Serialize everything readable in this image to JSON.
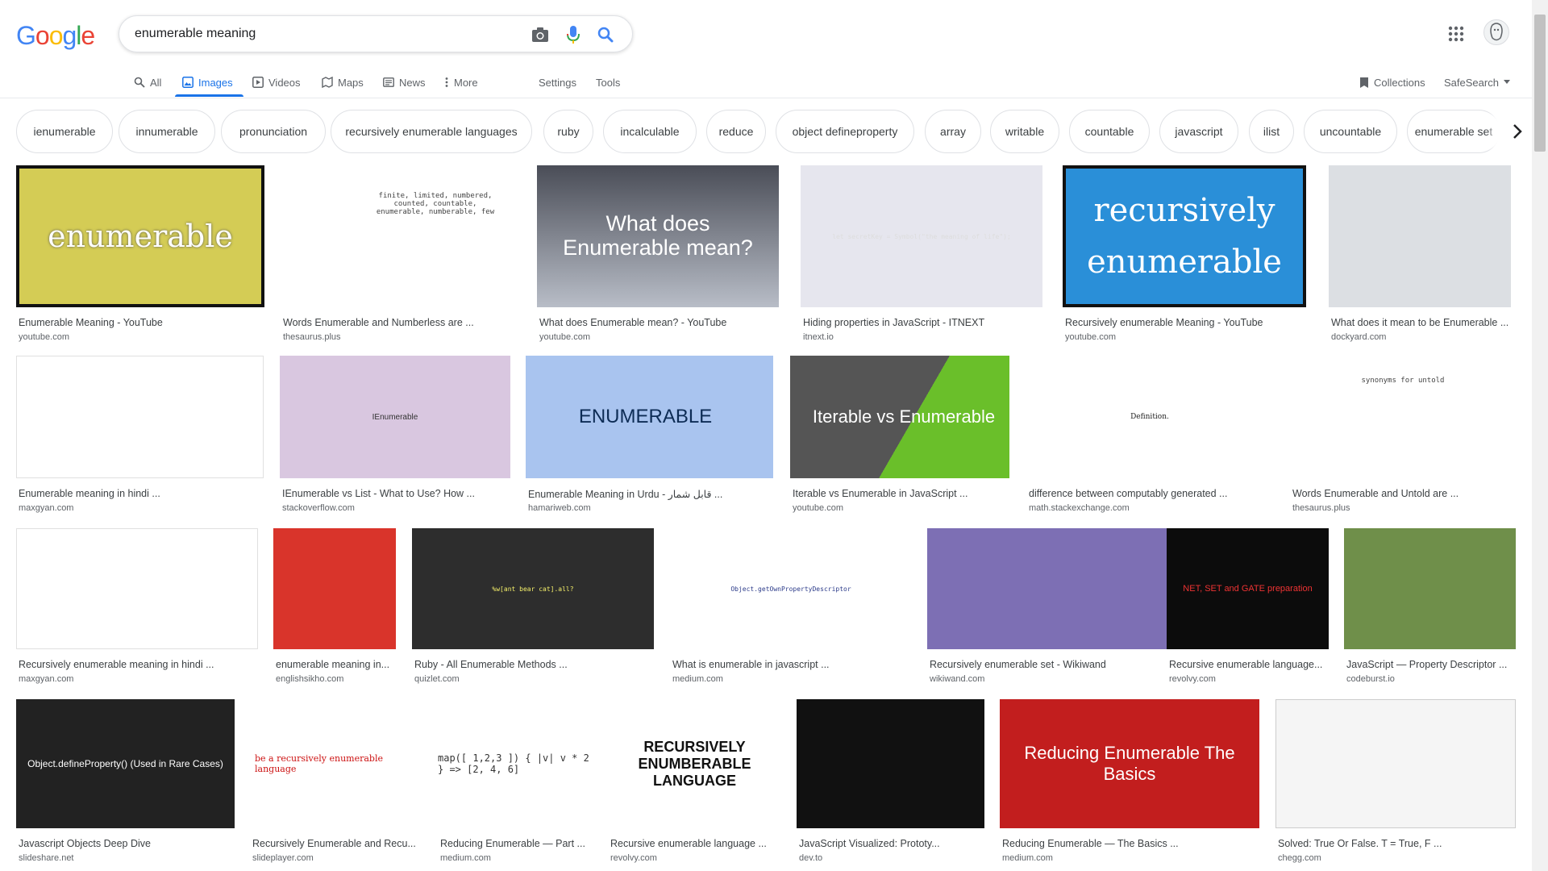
{
  "logo": {
    "letters": [
      "G",
      "o",
      "o",
      "g",
      "l",
      "e"
    ],
    "colors": [
      "#4285f4",
      "#ea4335",
      "#fbbc05",
      "#4285f4",
      "#34a853",
      "#ea4335"
    ]
  },
  "search": {
    "query": "enumerable meaning"
  },
  "nav": {
    "items": [
      {
        "label": "All",
        "icon": "search-icon",
        "active": false
      },
      {
        "label": "Images",
        "icon": "image-icon",
        "active": true
      },
      {
        "label": "Videos",
        "icon": "video-icon",
        "active": false
      },
      {
        "label": "Maps",
        "icon": "map-icon",
        "active": false
      },
      {
        "label": "News",
        "icon": "news-icon",
        "active": false
      },
      {
        "label": "More",
        "icon": "more-vert-icon",
        "active": false
      }
    ],
    "settings": "Settings",
    "tools": "Tools",
    "collections": "Collections",
    "safesearch": "SafeSearch"
  },
  "chips": [
    "ienumerable",
    "innumerable",
    "pronunciation",
    "recursively enumerable languages",
    "ruby",
    "incalculable",
    "reduce",
    "object defineproperty",
    "array",
    "writable",
    "countable",
    "javascript",
    "ilist",
    "uncountable",
    "enumerable set"
  ],
  "results": [
    {
      "title": "Enumerable Meaning - YouTube",
      "source": "youtube.com",
      "thumb_text": "enumerable"
    },
    {
      "title": "Words Enumerable and Numberless are ...",
      "source": "thesaurus.plus",
      "thumb_text": "finite, limited, numbered, counted, countable, enumerable, numberable, few"
    },
    {
      "title": "What does Enumerable mean? - YouTube",
      "source": "youtube.com",
      "thumb_text": "What does Enumerable mean?"
    },
    {
      "title": "Hiding properties in JavaScript - ITNEXT",
      "source": "itnext.io",
      "thumb_text": "let secretKey = Symbol(\"the meaning of life\");"
    },
    {
      "title": "Recursively enumerable Meaning - YouTube",
      "source": "youtube.com",
      "thumb_text": "recursively enumerable"
    },
    {
      "title": "What does it mean to be Enumerable ...",
      "source": "dockyard.com",
      "thumb_text": ""
    },
    {
      "title": "Enumerable meaning in hindi ...",
      "source": "maxgyan.com",
      "thumb_text": ""
    },
    {
      "title": "IEnumerable vs List - What to Use? How ...",
      "source": "stackoverflow.com",
      "thumb_text": "IEnumerable"
    },
    {
      "title": "Enumerable Meaning in Urdu - قابل شمار ...",
      "source": "hamariweb.com",
      "thumb_text": "ENUMERABLE"
    },
    {
      "title": "Iterable vs Enumerable in JavaScript ...",
      "source": "youtube.com",
      "thumb_text": "Iterable vs Enumerable"
    },
    {
      "title": "difference between computably generated ...",
      "source": "math.stackexchange.com",
      "thumb_text": "Definition."
    },
    {
      "title": "Words Enumerable and Untold are ...",
      "source": "thesaurus.plus",
      "thumb_text": "synonyms for untold"
    },
    {
      "title": "Recursively enumerable meaning in hindi ...",
      "source": "maxgyan.com",
      "thumb_text": ""
    },
    {
      "title": "enumerable meaning in...",
      "source": "englishsikho.com",
      "thumb_text": ""
    },
    {
      "title": "Ruby - All Enumerable Methods ...",
      "source": "quizlet.com",
      "thumb_text": "%w[ant bear cat].all?"
    },
    {
      "title": "What is enumerable in javascript ...",
      "source": "medium.com",
      "thumb_text": "Object.getOwnPropertyDescriptor"
    },
    {
      "title": "Recursively enumerable set - Wikiwand",
      "source": "wikiwand.com",
      "thumb_text": ""
    },
    {
      "title": "Recursive enumerable language...",
      "source": "revolvy.com",
      "thumb_text": "NET, SET and GATE preparation"
    },
    {
      "title": "JavaScript — Property Descriptor ...",
      "source": "codeburst.io",
      "thumb_text": ""
    },
    {
      "title": "Javascript Objects Deep Dive",
      "source": "slideshare.net",
      "thumb_text": "Object.defineProperty() (Used in Rare Cases)"
    },
    {
      "title": "Recursively Enumerable and Recu...",
      "source": "slideplayer.com",
      "thumb_text": "be a recursively enumerable language"
    },
    {
      "title": "Reducing Enumerable — Part ...",
      "source": "medium.com",
      "thumb_text": "map([ 1,2,3 ]) { |v| v * 2 } => [2, 4, 6]"
    },
    {
      "title": "Recursive enumerable language ...",
      "source": "revolvy.com",
      "thumb_text": "RECURSIVELY ENUMBERABLE LANGUAGE"
    },
    {
      "title": "JavaScript Visualized: Prototy...",
      "source": "dev.to",
      "thumb_text": ""
    },
    {
      "title": "Reducing Enumerable — The Basics ...",
      "source": "medium.com",
      "thumb_text": "Reducing Enumerable The Basics"
    },
    {
      "title": "Solved: True Or False. T = True, F ...",
      "source": "chegg.com",
      "thumb_text": ""
    }
  ],
  "colors": {
    "accent": "#1a73e8",
    "text": "#202124",
    "muted": "#5f6368"
  }
}
